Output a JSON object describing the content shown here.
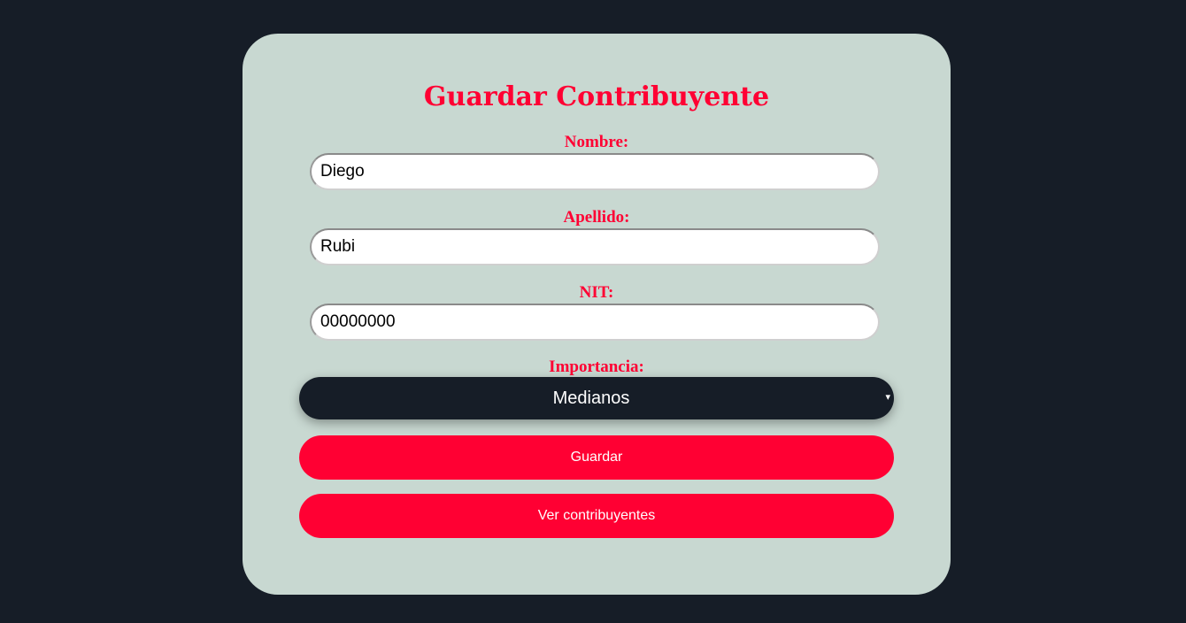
{
  "form": {
    "title": "Guardar Contribuyente",
    "fields": {
      "nombre": {
        "label": "Nombre:",
        "value": "Diego"
      },
      "apellido": {
        "label": "Apellido:",
        "value": "Rubi"
      },
      "nit": {
        "label": "NIT:",
        "value": "00000000"
      }
    },
    "importancia": {
      "label": "Importancia:",
      "selected": "Medianos",
      "arrow": "▾"
    },
    "buttons": {
      "save": "Guardar",
      "view": "Ver contribuyentes"
    }
  },
  "colors": {
    "background": "#161d27",
    "card": "#c8d8d1",
    "accent": "#ff0033",
    "select_bg": "#161d27"
  }
}
